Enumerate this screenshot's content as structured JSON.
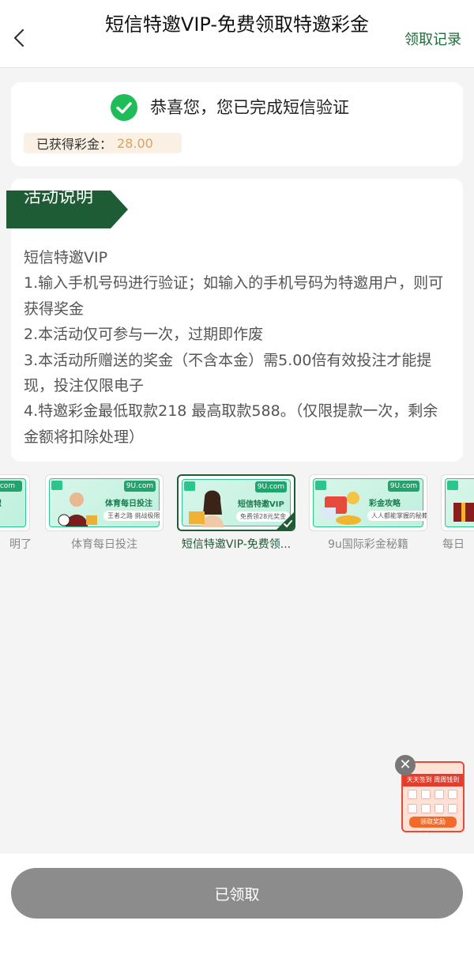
{
  "header": {
    "title": "短信特邀VIP-免费领取特邀彩金",
    "records_label": "领取记录"
  },
  "success": {
    "message": "恭喜您，您已完成短信验证",
    "bonus_label": "已获得彩金：",
    "bonus_amount": "28.00"
  },
  "rules": {
    "ribbon_label": "活动说明",
    "lines": [
      "短信特邀VIP",
      "1.输入手机号码进行验证；如输入的手机号码为特邀用户，则可获得奖金",
      "2.本活动仅可参与一次，过期即作废",
      "3.本活动所赠送的奖金（不含本金）需5.00倍有效投注才能提现，投注仅限电子",
      "4.特邀彩金最低取款218  最高取款588。（仅限提款一次，剩余金额将扣除处理）"
    ]
  },
  "carousel": {
    "items": [
      {
        "caption": "明了",
        "headline": "识",
        "sub": "",
        "badge": ".com"
      },
      {
        "caption": "体育每日投注",
        "headline": "体育每日投注",
        "sub": "王者之路 挑战极限",
        "badge": "9U.com"
      },
      {
        "caption": "短信特邀VIP-免费领...",
        "headline": "短信特邀VIP",
        "sub": "免费领28元奖金",
        "badge": "9U.com"
      },
      {
        "caption": "9u国际彩金秘籍",
        "headline": "彩金攻略",
        "sub": "人人都能掌握的秘籍",
        "badge": "9U.com"
      },
      {
        "caption": "每日",
        "headline": "",
        "sub": "",
        "badge": ""
      }
    ]
  },
  "float_widget": {
    "close_glyph": "✕",
    "banner": "天天签到 周周钱到",
    "button": "领取奖励"
  },
  "bottom": {
    "claim_label": "已领取"
  },
  "colors": {
    "accent_green": "#1e5b36",
    "bonus_amount": "#d9a268",
    "disabled_button": "#8c8c8c"
  }
}
